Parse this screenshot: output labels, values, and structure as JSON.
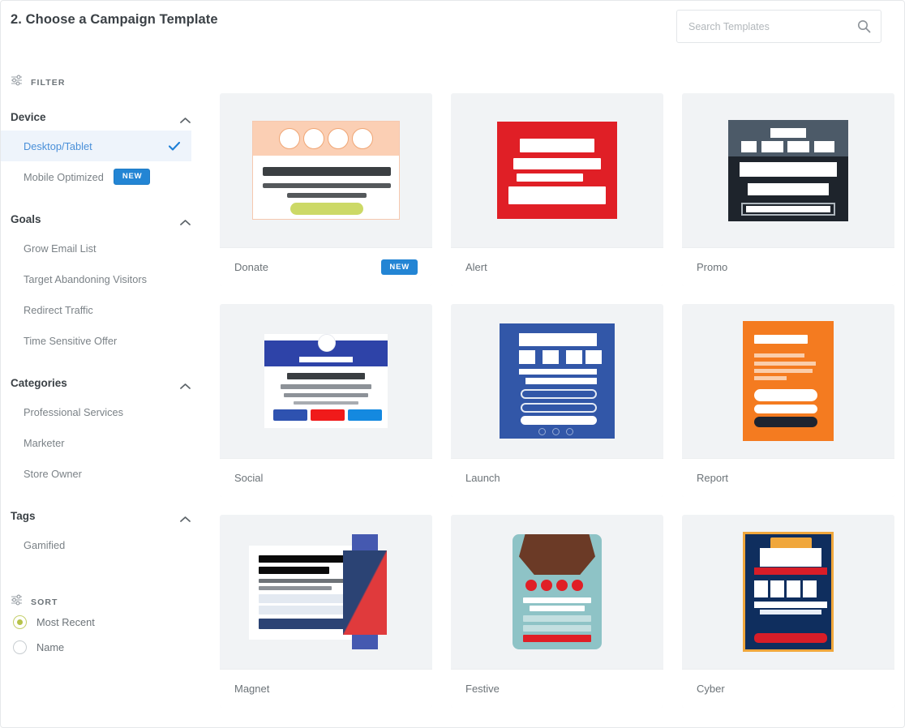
{
  "header": {
    "title": "2. Choose a Campaign Template",
    "search": {
      "placeholder": "Search Templates",
      "value": "",
      "icon": "search-icon"
    }
  },
  "sidebar": {
    "filter_label": "FILTER",
    "filter_icon": "filter-sliders-icon",
    "sort_label": "SORT",
    "sort_icon": "sort-sliders-icon",
    "facets": [
      {
        "title": "Device",
        "collapse_icon": "chevron-up-icon",
        "options": [
          {
            "label": "Desktop/Tablet",
            "selected": true,
            "check_icon": "check-icon",
            "badge": ""
          },
          {
            "label": "Mobile Optimized",
            "selected": false,
            "badge": "NEW"
          }
        ]
      },
      {
        "title": "Goals",
        "collapse_icon": "chevron-up-icon",
        "options": [
          {
            "label": "Grow Email List",
            "selected": false,
            "badge": ""
          },
          {
            "label": "Target Abandoning Visitors",
            "selected": false,
            "badge": ""
          },
          {
            "label": "Redirect Traffic",
            "selected": false,
            "badge": ""
          },
          {
            "label": "Time Sensitive Offer",
            "selected": false,
            "badge": ""
          }
        ]
      },
      {
        "title": "Categories",
        "collapse_icon": "chevron-up-icon",
        "options": [
          {
            "label": "Professional Services",
            "selected": false,
            "badge": ""
          },
          {
            "label": "Marketer",
            "selected": false,
            "badge": ""
          },
          {
            "label": "Store Owner",
            "selected": false,
            "badge": ""
          }
        ]
      },
      {
        "title": "Tags",
        "collapse_icon": "chevron-up-icon",
        "options": [
          {
            "label": "Gamified",
            "selected": false,
            "badge": ""
          }
        ]
      }
    ],
    "sort_options": [
      {
        "label": "Most Recent",
        "selected": true
      },
      {
        "label": "Name",
        "selected": false
      }
    ]
  },
  "templates": [
    {
      "name": "Donate",
      "badge": "NEW",
      "art": "donate"
    },
    {
      "name": "Alert",
      "badge": "",
      "art": "alert"
    },
    {
      "name": "Promo",
      "badge": "",
      "art": "promo"
    },
    {
      "name": "Social",
      "badge": "",
      "art": "social"
    },
    {
      "name": "Launch",
      "badge": "",
      "art": "launch"
    },
    {
      "name": "Report",
      "badge": "",
      "art": "report"
    },
    {
      "name": "Magnet",
      "badge": "",
      "art": "magnet"
    },
    {
      "name": "Festive",
      "badge": "",
      "art": "festive"
    },
    {
      "name": "Cyber",
      "badge": "",
      "art": "cyber"
    }
  ],
  "colors": {
    "accent_blue": "#2385d4",
    "selected_bg": "#eef4fb",
    "selected_text": "#4a90d9",
    "radio_green": "#b6c24a",
    "card_bg": "#f1f3f5",
    "text_dark": "#3b4146",
    "text_muted": "#7b8287"
  }
}
